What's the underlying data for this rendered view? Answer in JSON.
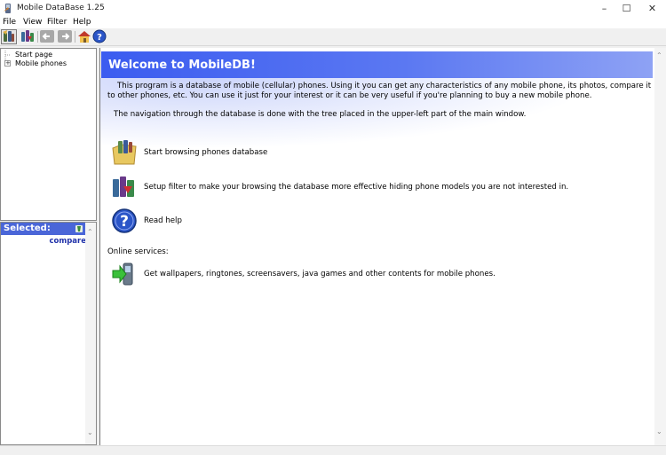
{
  "window": {
    "title": "Mobile DataBase 1.25",
    "controls": {
      "minimize": "–",
      "maximize": "☐",
      "close": "✕"
    }
  },
  "menu": {
    "items": [
      "File",
      "View",
      "Filter",
      "Help"
    ]
  },
  "toolbar": {
    "buttons": [
      "phones-icon",
      "filter-icon",
      "back-arrow-icon",
      "forward-arrow-icon",
      "home-icon",
      "help-icon"
    ]
  },
  "tree": {
    "items": [
      "Start page",
      "Mobile phones"
    ]
  },
  "selected": {
    "header": "Selected:",
    "compare": "compare"
  },
  "main": {
    "title": "Welcome to MobileDB!",
    "intro_line1": "This program is a database of mobile (cellular) phones. Using it you can get any characteristics of any mobile phone, its photos, compare it",
    "intro_line2": "to other phones, etc. You can use it just for your interest or it can be very useful if you're planning to buy a new mobile phone.",
    "navigation": "The navigation through the database is done with the tree placed in the upper-left part of the main window.",
    "actions": [
      {
        "icon": "phones-database-icon",
        "label": "Start browsing phones database"
      },
      {
        "icon": "filter-phones-icon",
        "label": "Setup filter to make your browsing the database more effective hiding phone models you are not interested in."
      },
      {
        "icon": "help-icon",
        "label": "Read help"
      }
    ],
    "online_label": "Online services:",
    "online_action": {
      "icon": "download-phone-icon",
      "label": "Get wallpapers, ringtones, screensavers, java games and other contents for mobile phones."
    }
  },
  "colors": {
    "banner": "#3b5cf0",
    "selected_header": "#4a66d8",
    "compare_link": "#2233aa"
  }
}
